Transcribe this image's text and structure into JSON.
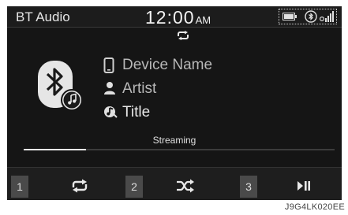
{
  "statusbar": {
    "app_title": "BT Audio",
    "time": "12:00",
    "ampm": "AM"
  },
  "icons": {
    "repeat": "repeat-icon",
    "bluetooth_music": "bluetooth-music-icon",
    "device": "phone-icon",
    "artist": "person-icon",
    "title": "music-note-icon",
    "shuffle": "shuffle-icon",
    "play_pause": "play-pause-icon",
    "battery": "battery-icon",
    "bluetooth_status": "bluetooth-status-icon",
    "signal": "signal-icon"
  },
  "track": {
    "device_name": "Device Name",
    "artist": "Artist",
    "title": "Title",
    "status": "Streaming",
    "progress": 0.2
  },
  "bottombar": {
    "preset_1": "1",
    "preset_2": "2",
    "preset_3": "3"
  },
  "caption": "J9G4LK020EE"
}
